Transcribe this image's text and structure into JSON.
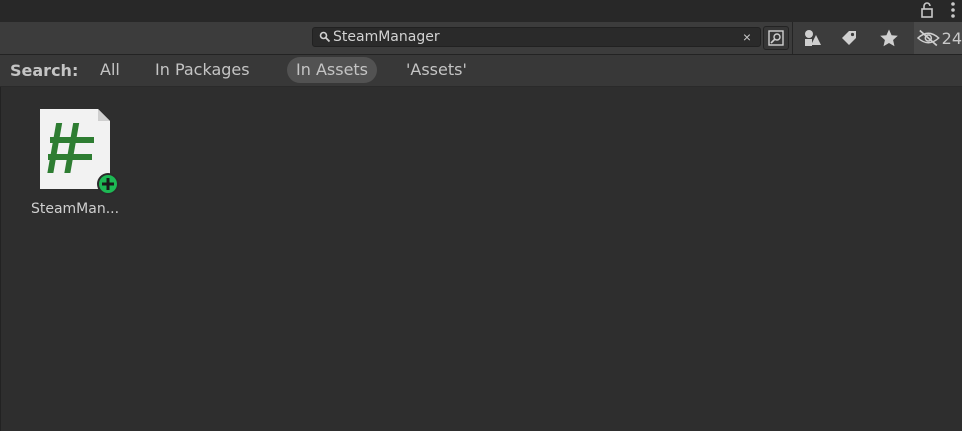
{
  "toolbar": {
    "search_value": "SteamManager",
    "clear_glyph": "×",
    "hidden_count": "24",
    "icons": [
      "lock-icon",
      "kebab-menu-icon",
      "search-icon",
      "clear-icon",
      "open-search-window-icon",
      "filter-by-type-icon",
      "filter-by-label-icon",
      "favorites-star-icon",
      "hidden-packages-eye-icon"
    ]
  },
  "scope_bar": {
    "label": "Search:",
    "tabs": [
      {
        "label": "All",
        "active": false
      },
      {
        "label": "In Packages",
        "active": false
      },
      {
        "label": "In Assets",
        "active": true
      },
      {
        "label": "'Assets'",
        "active": false
      }
    ]
  },
  "assets": [
    {
      "name": "SteamMan...",
      "icon": "csharp-script-icon",
      "badge": "add-badge-icon"
    }
  ],
  "colors": {
    "background": "#2e2e2e",
    "toolbar": "#3c3c3c",
    "scope_active": "#525252",
    "script_hash": "#2e7d32",
    "add_badge": "#1db954"
  }
}
